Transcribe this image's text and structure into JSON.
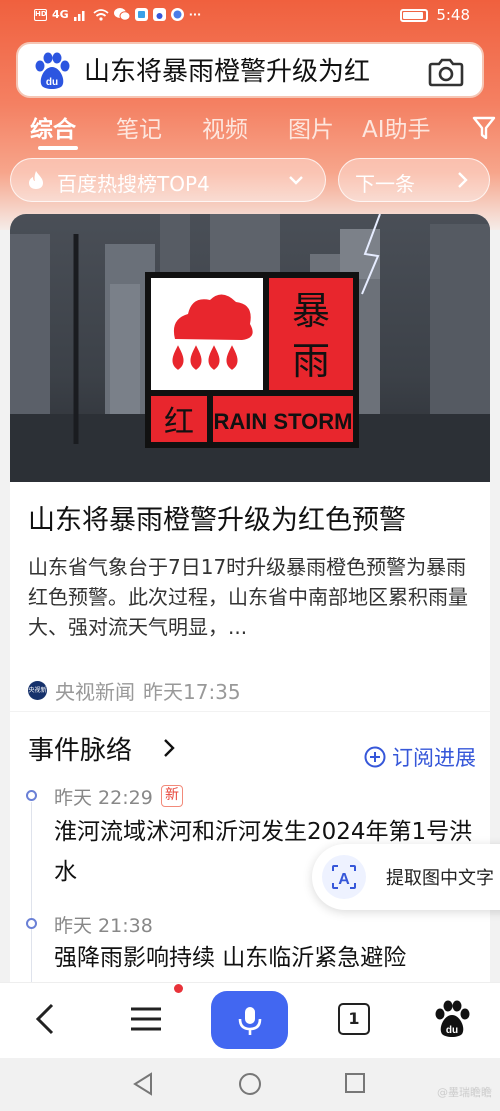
{
  "status_bar": {
    "carrier": "HD",
    "signal": "4G",
    "time": "5:48"
  },
  "search": {
    "query": "山东将暴雨橙警升级为红"
  },
  "tabs": [
    {
      "label": "综合",
      "active": true
    },
    {
      "label": "笔记"
    },
    {
      "label": "视频"
    },
    {
      "label": "图片"
    },
    {
      "label": "AI助手"
    }
  ],
  "hot_pill": {
    "label": "百度热搜榜TOP4",
    "next_label": "下一条"
  },
  "hero": {
    "warning_big": "暴",
    "warning_big2": "雨",
    "warning_red": "红",
    "warning_en": "RAIN STORM"
  },
  "article": {
    "title": "山东将暴雨橙警升级为红色预警",
    "description": "山东省气象台于7日17时升级暴雨橙色预警为暴雨红色预警。此次过程，山东省中南部地区累积雨量大、强对流天气明显，...",
    "source": "央视新闻",
    "source_logo_text": "央视新闻",
    "time": "昨天17:35"
  },
  "timeline": {
    "heading": "事件脉络",
    "subscribe": "订阅进展",
    "items": [
      {
        "time": "昨天 22:29",
        "badge": "新",
        "text": "淮河流域沭河和沂河发生2024年第1号洪水"
      },
      {
        "time": "昨天 21:38",
        "text": "强降雨影响持续 山东临沂紧急避险"
      }
    ]
  },
  "ocr_button": {
    "label": "提取图中文字"
  },
  "bottom_nav": {
    "tab_count": "1"
  },
  "watermark": "@墨瑞瞻瞻",
  "colors": {
    "brand_blue": "#4267f1",
    "top_gradient": "#f0603e",
    "warning_red": "#e8262d"
  }
}
